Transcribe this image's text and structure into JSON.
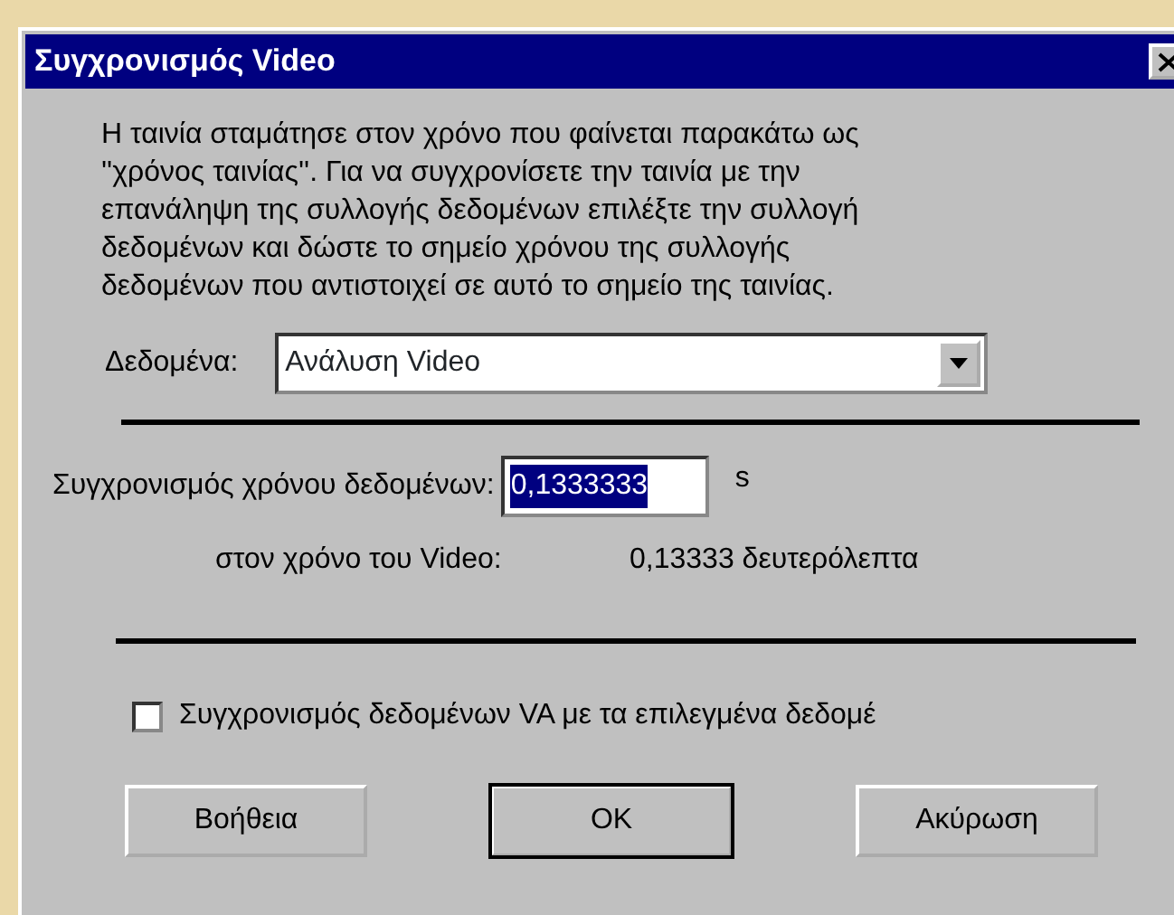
{
  "window": {
    "title": "Συγχρονισμός Video"
  },
  "message_lines": [
    "Η ταινία σταμάτησε στον χρόνο που φαίνεται παρακάτω ως",
    "''χρόνος ταινίας''. Για να συγχρονίσετε την ταινία με την",
    "επανάληψη της συλλογής δεδομένων επιλέξτε την συλλογή",
    "δεδομένων και δώστε το σημείο χρόνου της συλλογής",
    "δεδομένων που αντιστοιχεί σε αυτό το σημείο της ταινίας."
  ],
  "data_select": {
    "label": "Δεδομένα:",
    "value": "Ανάλυση Video"
  },
  "sync_time": {
    "label": "Συγχρονισμός χρόνου δεδομένων:",
    "value": "0,1333333",
    "selected": true,
    "unit": "s"
  },
  "video_time": {
    "label": "στον χρόνο του Video:",
    "value": "0,13333 δευτερόλεπτα"
  },
  "checkbox": {
    "label": "Συγχρονισμός δεδομένων VA με τα επιλεγμένα δεδομέ",
    "checked": false
  },
  "buttons": [
    {
      "label": "Βοήθεια",
      "default": false
    },
    {
      "label": "OK",
      "default": true
    },
    {
      "label": "Ακύρωση",
      "default": false
    }
  ]
}
